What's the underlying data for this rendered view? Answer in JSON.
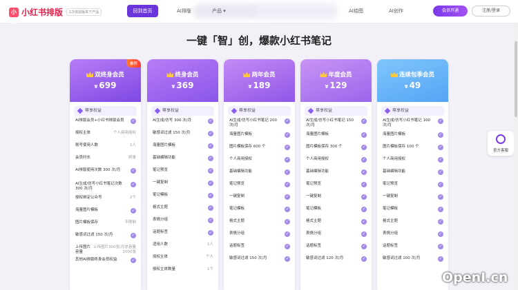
{
  "header": {
    "logo_mark": "小红",
    "logo_text": "小红书排版",
    "logo_tag": "1次体验版本下产品",
    "nav": [
      "回到首页",
      "AI排版",
      "产品 ▾",
      "AI绘图",
      "AI创作"
    ],
    "vip_button": "会员开通",
    "login_button": "注册/登录"
  },
  "heading": "一键「智」创，爆款小红书笔记",
  "tier_label": "尊享权益",
  "currency": "¥",
  "cards": [
    {
      "name": "双终身会员",
      "price": "699",
      "badge": "推荐",
      "gradient": [
        "#b77cf6",
        "#7e48e3"
      ],
      "features": [
        {
          "t": "AI排版会员+小红书排版会员",
          "r": "",
          "c": true
        },
        {
          "t": "授权主体",
          "r": "个人商用授权",
          "c": false
        },
        {
          "t": "账号使用人数",
          "r": "1人",
          "c": false
        },
        {
          "t": "会员时长",
          "r": "终身",
          "c": false
        },
        {
          "t": "AI排版使用次数 300 次/月",
          "r": "",
          "c": true
        },
        {
          "t": "AI生成/仿写小红书笔记次数 300 次/月",
          "r": "",
          "c": true
        },
        {
          "t": "授权绑定公众号",
          "r": "2个",
          "c": false
        },
        {
          "t": "海量图片模板",
          "r": "",
          "c": true
        },
        {
          "t": "图片模板保存",
          "r": "不限制",
          "c": false
        },
        {
          "t": "敏感词过滤 150 次/月",
          "r": "",
          "c": true
        },
        {
          "t": "上传图片容量",
          "r": "上传图片300张/月总容量1000张",
          "c": false
        },
        {
          "t": "其他AI排版终身会员权益",
          "r": "",
          "c": true
        }
      ]
    },
    {
      "name": "终身会员",
      "price": "369",
      "badge": "",
      "gradient": [
        "#b77cf6",
        "#8a55ea"
      ],
      "features": [
        {
          "t": "AI生成/仿写 300 次/月",
          "r": "",
          "c": true
        },
        {
          "t": "敏感词过滤 150 次/月",
          "r": "",
          "c": true
        },
        {
          "t": "海量图片模板",
          "r": "",
          "c": true
        },
        {
          "t": "基础编辑功能",
          "r": "",
          "c": true
        },
        {
          "t": "笔记预览",
          "r": "",
          "c": true
        },
        {
          "t": "一键复制",
          "r": "",
          "c": true
        },
        {
          "t": "笔记模板",
          "r": "",
          "c": true
        },
        {
          "t": "格式主题",
          "r": "",
          "c": true
        },
        {
          "t": "表情分组",
          "r": "",
          "c": true
        },
        {
          "t": "话题标签",
          "r": "",
          "c": true
        },
        {
          "t": "适用人数",
          "r": "1人",
          "c": false
        },
        {
          "t": "授权主体",
          "r": "个人",
          "c": false
        },
        {
          "t": "授权主体数量",
          "r": "1个",
          "c": false
        }
      ]
    },
    {
      "name": "两年会员",
      "price": "189",
      "badge": "",
      "gradient": [
        "#c48af5",
        "#8f57e8"
      ],
      "features": [
        {
          "t": "AI生成/仿写小红书笔记 200 次/月",
          "r": "",
          "c": true
        },
        {
          "t": "海量图片模板",
          "r": "",
          "c": true
        },
        {
          "t": "图片模板保存 600 个",
          "r": "",
          "c": true
        },
        {
          "t": "个人商用授权",
          "r": "",
          "c": true
        },
        {
          "t": "基础编辑功能",
          "r": "",
          "c": true
        },
        {
          "t": "笔记预览",
          "r": "",
          "c": true
        },
        {
          "t": "一键复制",
          "r": "",
          "c": true
        },
        {
          "t": "笔记模板",
          "r": "",
          "c": true
        },
        {
          "t": "格式主题",
          "r": "",
          "c": true
        },
        {
          "t": "表情分组",
          "r": "",
          "c": true
        },
        {
          "t": "话题标签",
          "r": "",
          "c": true
        },
        {
          "t": "敏感词过滤 150 次/月",
          "r": "",
          "c": true
        }
      ]
    },
    {
      "name": "年度会员",
      "price": "129",
      "badge": "",
      "gradient": [
        "#c894f4",
        "#9a66ec"
      ],
      "features": [
        {
          "t": "AI生成/仿写小红书笔记 150 次/月",
          "r": "",
          "c": true
        },
        {
          "t": "海量图片模板",
          "r": "",
          "c": true
        },
        {
          "t": "图片模板保存 300 个",
          "r": "",
          "c": true
        },
        {
          "t": "个人商用授权",
          "r": "",
          "c": true
        },
        {
          "t": "基础编辑功能",
          "r": "",
          "c": true
        },
        {
          "t": "笔记预览",
          "r": "",
          "c": true
        },
        {
          "t": "一键复制",
          "r": "",
          "c": true
        },
        {
          "t": "笔记模板",
          "r": "",
          "c": true
        },
        {
          "t": "格式主题",
          "r": "",
          "c": true
        },
        {
          "t": "表情分组",
          "r": "",
          "c": true
        },
        {
          "t": "话题标签",
          "r": "",
          "c": true
        },
        {
          "t": "敏感词过滤 120 次/月",
          "r": "",
          "c": true
        }
      ]
    },
    {
      "name": "连续包季会员",
      "price": "49",
      "badge": "",
      "gradient": [
        "#7fc6fb",
        "#55a4f5"
      ],
      "features": [
        {
          "t": "AI生成/仿写小红书笔记 100 次/月",
          "r": "",
          "c": true
        },
        {
          "t": "海量图片模板",
          "r": "",
          "c": true
        },
        {
          "t": "图片模板保存 100 个",
          "r": "",
          "c": true
        },
        {
          "t": "个人商用授权",
          "r": "",
          "c": true
        },
        {
          "t": "基础编辑功能",
          "r": "",
          "c": true
        },
        {
          "t": "笔记预览",
          "r": "",
          "c": true
        },
        {
          "t": "一键复制",
          "r": "",
          "c": true
        },
        {
          "t": "笔记模板",
          "r": "",
          "c": true
        },
        {
          "t": "格式主题",
          "r": "",
          "c": true
        },
        {
          "t": "表情分组",
          "r": "",
          "c": true
        },
        {
          "t": "话题标签",
          "r": "",
          "c": true
        },
        {
          "t": "敏感词过滤 100 次/月",
          "r": "",
          "c": true
        }
      ]
    }
  ],
  "side_button": "官方客服",
  "watermark": "OpenI.cn"
}
